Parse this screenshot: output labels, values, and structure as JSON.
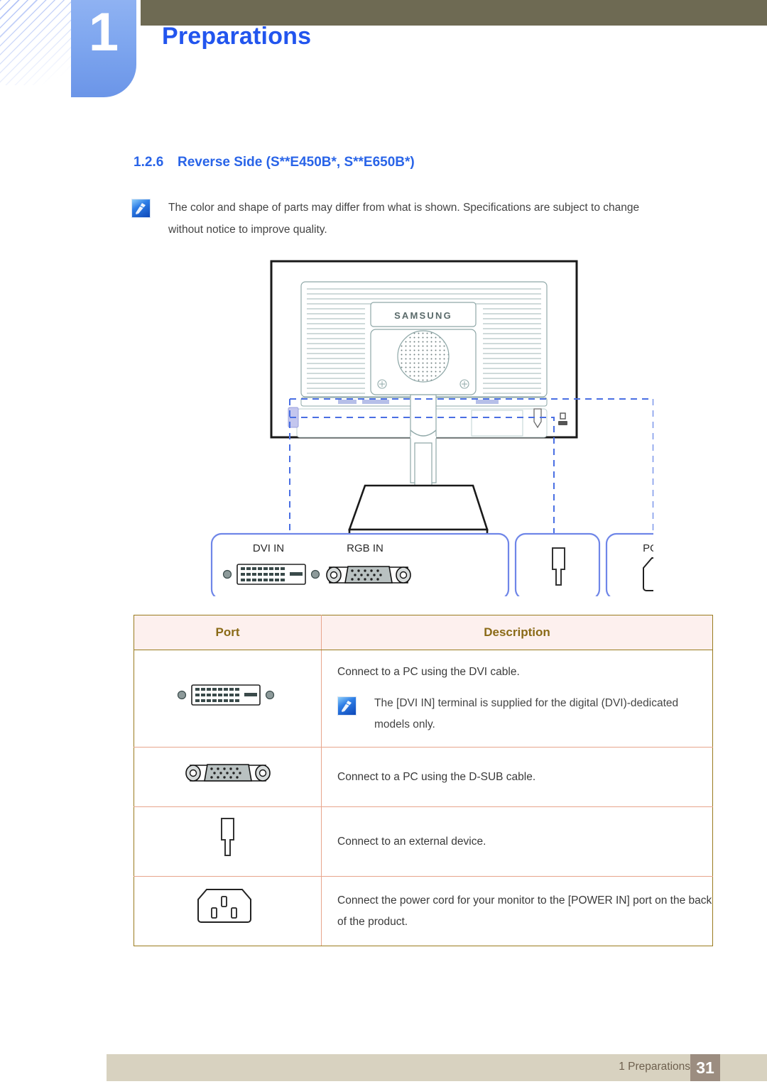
{
  "header": {
    "chapter_number": "1",
    "chapter_title": "Preparations",
    "accent_blue": "#2255ee",
    "olive_bar_color": "#6e6a53",
    "tab_color": "#7ea6ef"
  },
  "section": {
    "number": "1.2.6",
    "title": "Reverse Side (S**E450B*, S**E650B*)",
    "title_color": "#2964e8",
    "note_icon": "note-pen-icon",
    "note_text": "The color and shape of parts may differ from what is shown. Specifications are subject to change without notice to improve quality."
  },
  "diagram": {
    "brand_logo": "SAMSUNG",
    "callouts": [
      {
        "id": "dvi",
        "labels": [
          "DVI IN",
          "RGB IN"
        ],
        "icons": [
          "dvi-port-icon",
          "vga-port-icon"
        ]
      },
      {
        "id": "headphone",
        "labels": [],
        "icons": [
          "headphone-jack-icon"
        ]
      },
      {
        "id": "power",
        "labels": [
          "POWER IN"
        ],
        "icons": [
          "power-inlet-icon"
        ]
      }
    ],
    "callout_border_color": "#6f86e8"
  },
  "table": {
    "headers": {
      "port": "Port",
      "description": "Description"
    },
    "header_bg": "#fdf0ee",
    "header_text_color": "#8a6a17",
    "border_color": "#9a7b1e",
    "row_divider_color": "#e8a58c",
    "rows": [
      {
        "port_icon": "dvi-port-icon",
        "description": "Connect to a PC using the DVI cable.",
        "sub_note_icon": "note-pen-icon",
        "sub_note": "The [DVI IN] terminal is supplied for the digital (DVI)-dedicated models only."
      },
      {
        "port_icon": "vga-port-icon",
        "description": "Connect to a PC using the D-SUB cable.",
        "sub_note_icon": null,
        "sub_note": null
      },
      {
        "port_icon": "headphone-jack-icon",
        "description": "Connect to an external device.",
        "sub_note_icon": null,
        "sub_note": null
      },
      {
        "port_icon": "power-inlet-icon",
        "description": "Connect the power cord for your monitor to the [POWER IN] port on the back of the product.",
        "sub_note_icon": null,
        "sub_note": null
      }
    ]
  },
  "footer": {
    "label": "1 Preparations",
    "page_number": "31",
    "bar_color": "#d8d2c0",
    "page_box_color": "#9c8d80"
  }
}
